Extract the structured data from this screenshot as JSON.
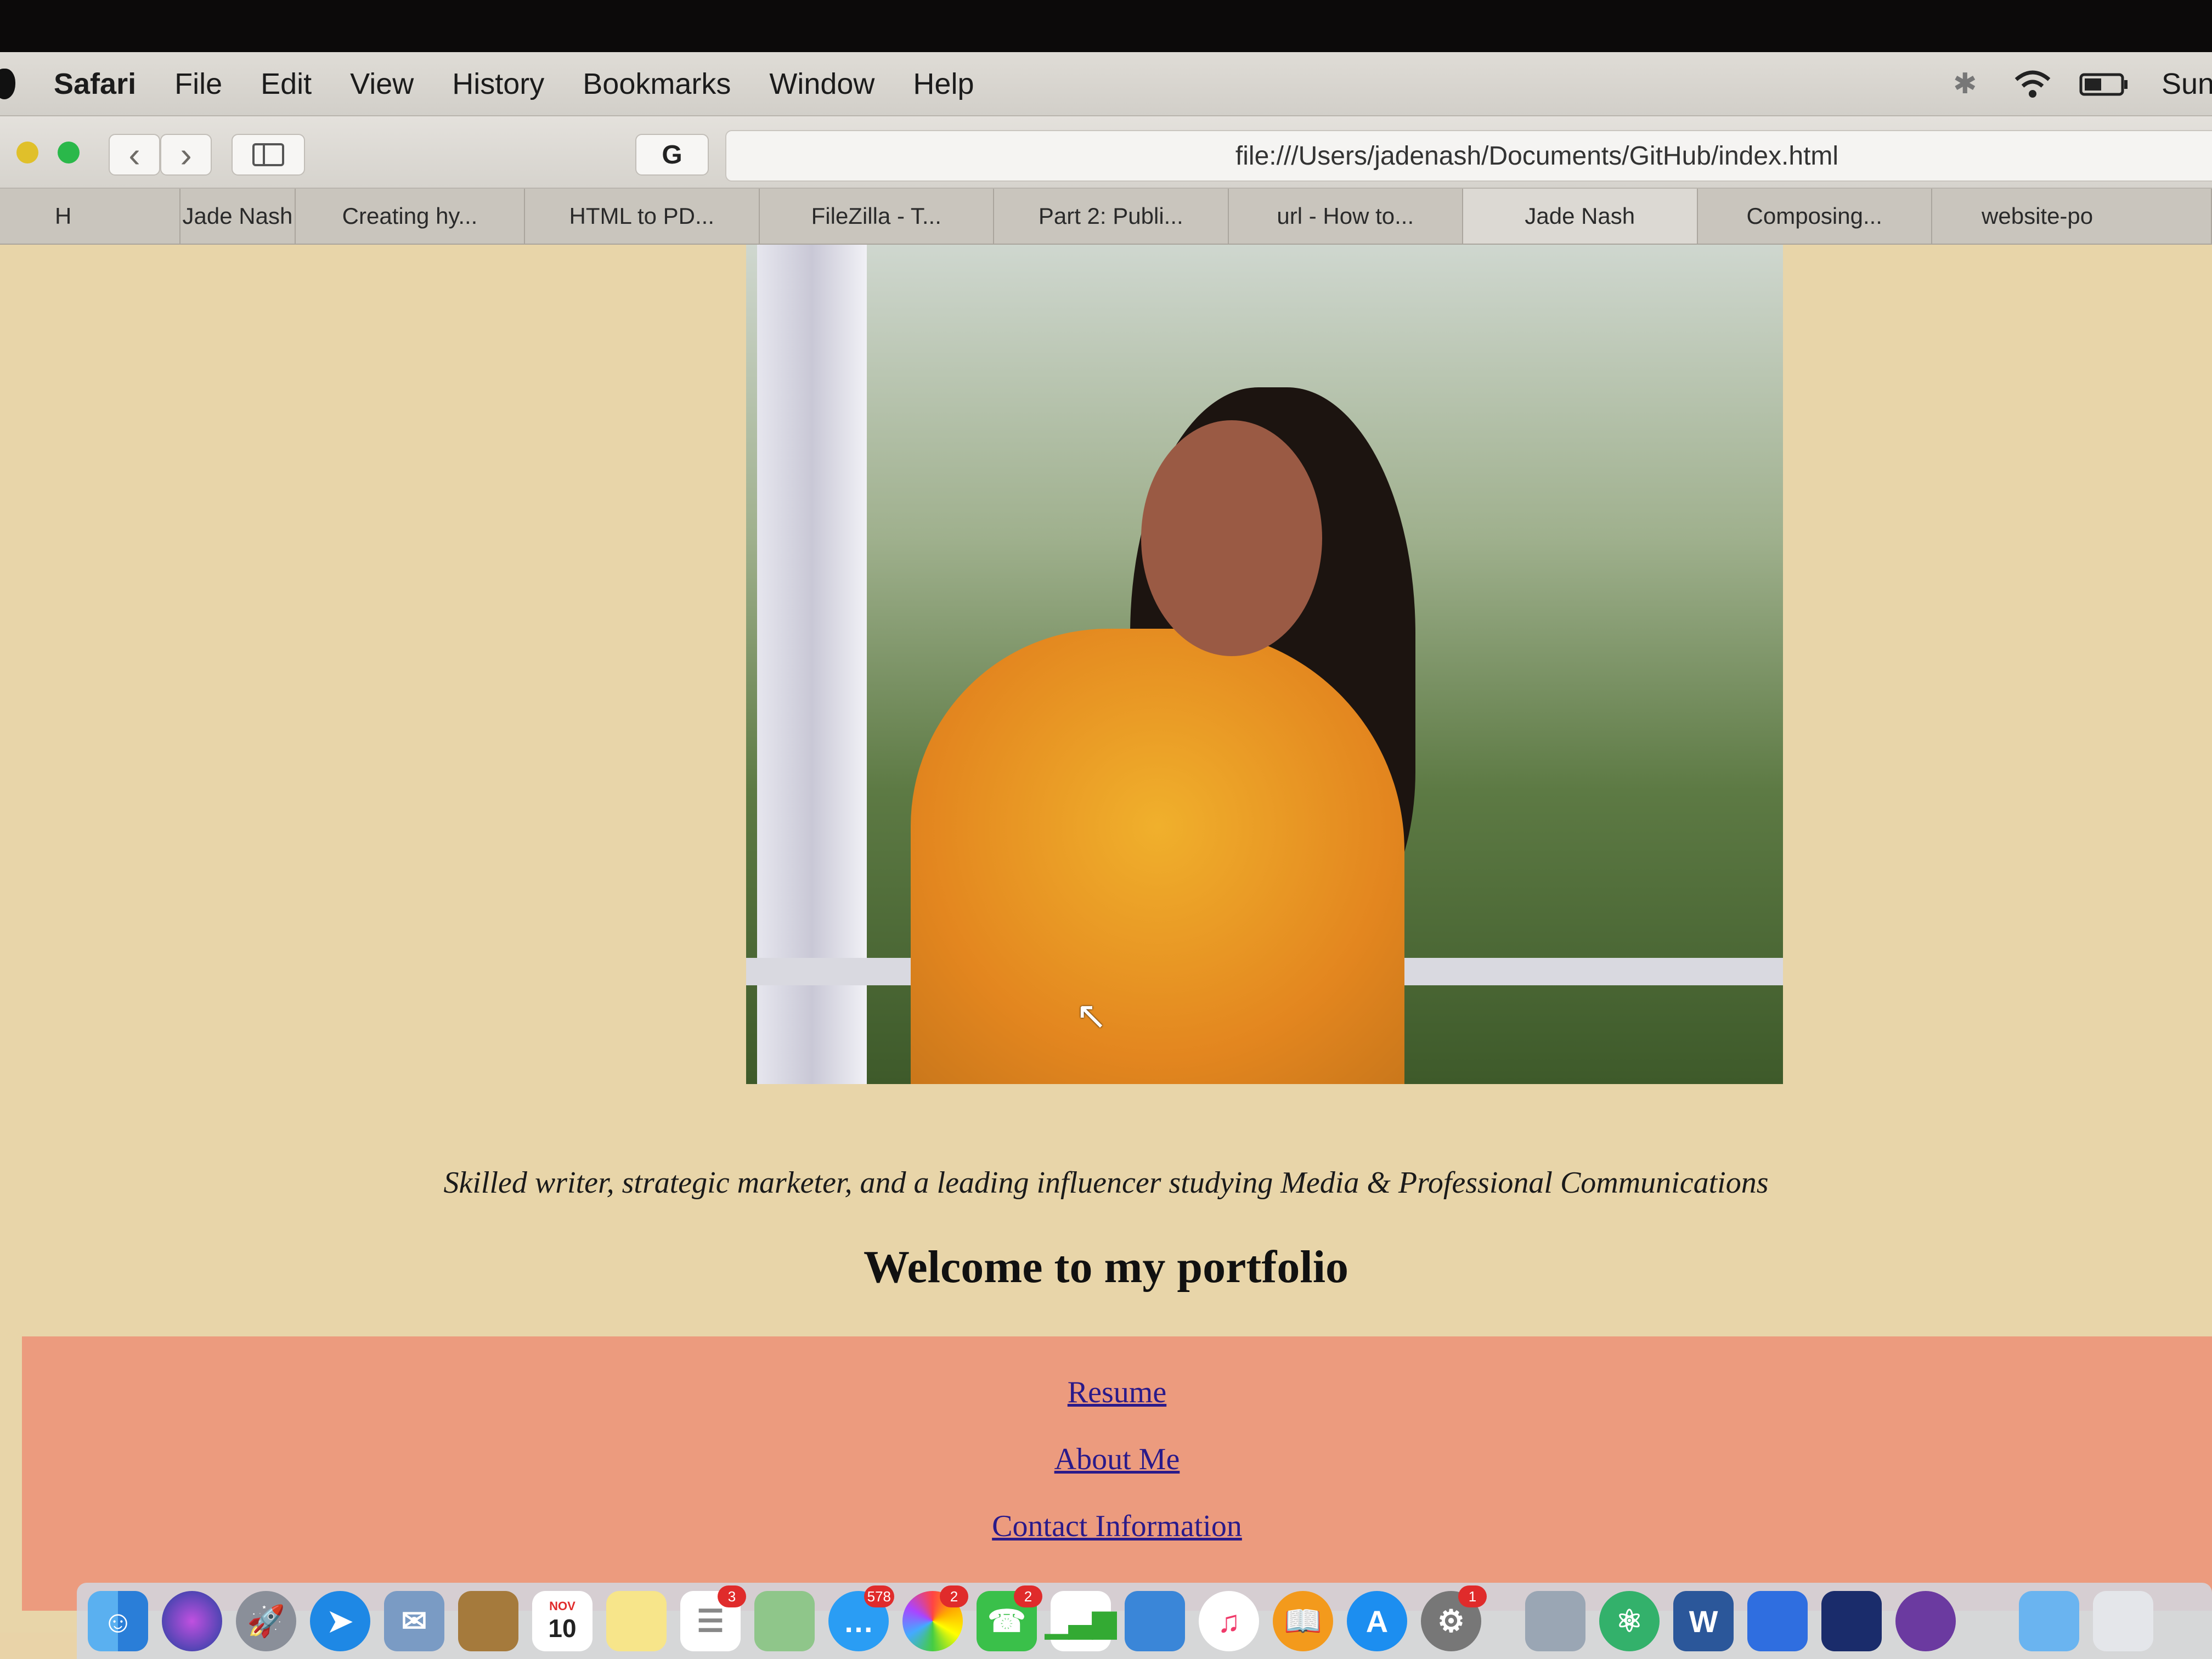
{
  "menubar": {
    "app_name": "Safari",
    "items": [
      "File",
      "Edit",
      "View",
      "History",
      "Bookmarks",
      "Window",
      "Help"
    ],
    "clock": "Sun"
  },
  "toolbar": {
    "url": "file:///Users/jadenash/Documents/GitHub/index.html",
    "grammarly_label": "G"
  },
  "tabs": [
    {
      "label": "H"
    },
    {
      "label": "Jade Nash"
    },
    {
      "label": "Creating hy..."
    },
    {
      "label": "HTML to PD..."
    },
    {
      "label": "FileZilla - T..."
    },
    {
      "label": "Part 2: Publi..."
    },
    {
      "label": "url - How to..."
    },
    {
      "label": "Jade Nash"
    },
    {
      "label": "Composing..."
    },
    {
      "label": "website-po"
    }
  ],
  "page": {
    "tagline": "Skilled writer, strategic marketer, and a leading influencer studying Media & Professional Communications",
    "heading": "Welcome to my portfolio",
    "links": [
      {
        "label": "Resume"
      },
      {
        "label": "About Me"
      },
      {
        "label": "Contact Information"
      }
    ]
  },
  "dock": {
    "calendar_month": "NOV",
    "calendar_day": "10",
    "badges": {
      "reminders": "3",
      "messages": "578",
      "photos": "2",
      "facetime": "2",
      "system_preferences": "1"
    }
  },
  "colors": {
    "page_background": "#e8d5a9",
    "links_panel": "#ec9b7e",
    "link_text": "#2a1a8a"
  }
}
